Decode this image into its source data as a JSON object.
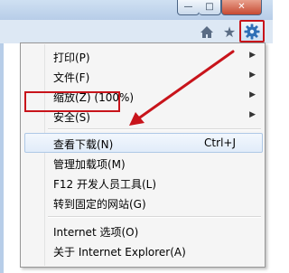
{
  "window_buttons": {
    "minimize": "—",
    "maximize": "□",
    "close": "✕"
  },
  "toolbar": {
    "home_icon": "home-icon",
    "favorites_icon": "star-icon",
    "tools_icon": "gear-icon"
  },
  "menu": {
    "items": [
      {
        "label": "打印(P)",
        "shortcut": "",
        "submenu": true
      },
      {
        "label": "文件(F)",
        "shortcut": "",
        "submenu": true
      },
      {
        "label": "缩放(Z) (100%)",
        "shortcut": "",
        "submenu": true
      },
      {
        "label": "安全(S)",
        "shortcut": "",
        "submenu": true
      },
      {
        "label": "查看下载(N)",
        "shortcut": "Ctrl+J",
        "submenu": false
      },
      {
        "label": "管理加载项(M)",
        "shortcut": "",
        "submenu": false
      },
      {
        "label": "F12 开发人员工具(L)",
        "shortcut": "",
        "submenu": false
      },
      {
        "label": "转到固定的网站(G)",
        "shortcut": "",
        "submenu": false
      },
      {
        "label": "Internet 选项(O)",
        "shortcut": "",
        "submenu": false
      },
      {
        "label": "关于 Internet Explorer(A)",
        "shortcut": "",
        "submenu": false
      }
    ],
    "highlighted_index": 4
  },
  "colors": {
    "annotation_red": "#c8141b",
    "menu_bg": "#f5f5f5"
  }
}
